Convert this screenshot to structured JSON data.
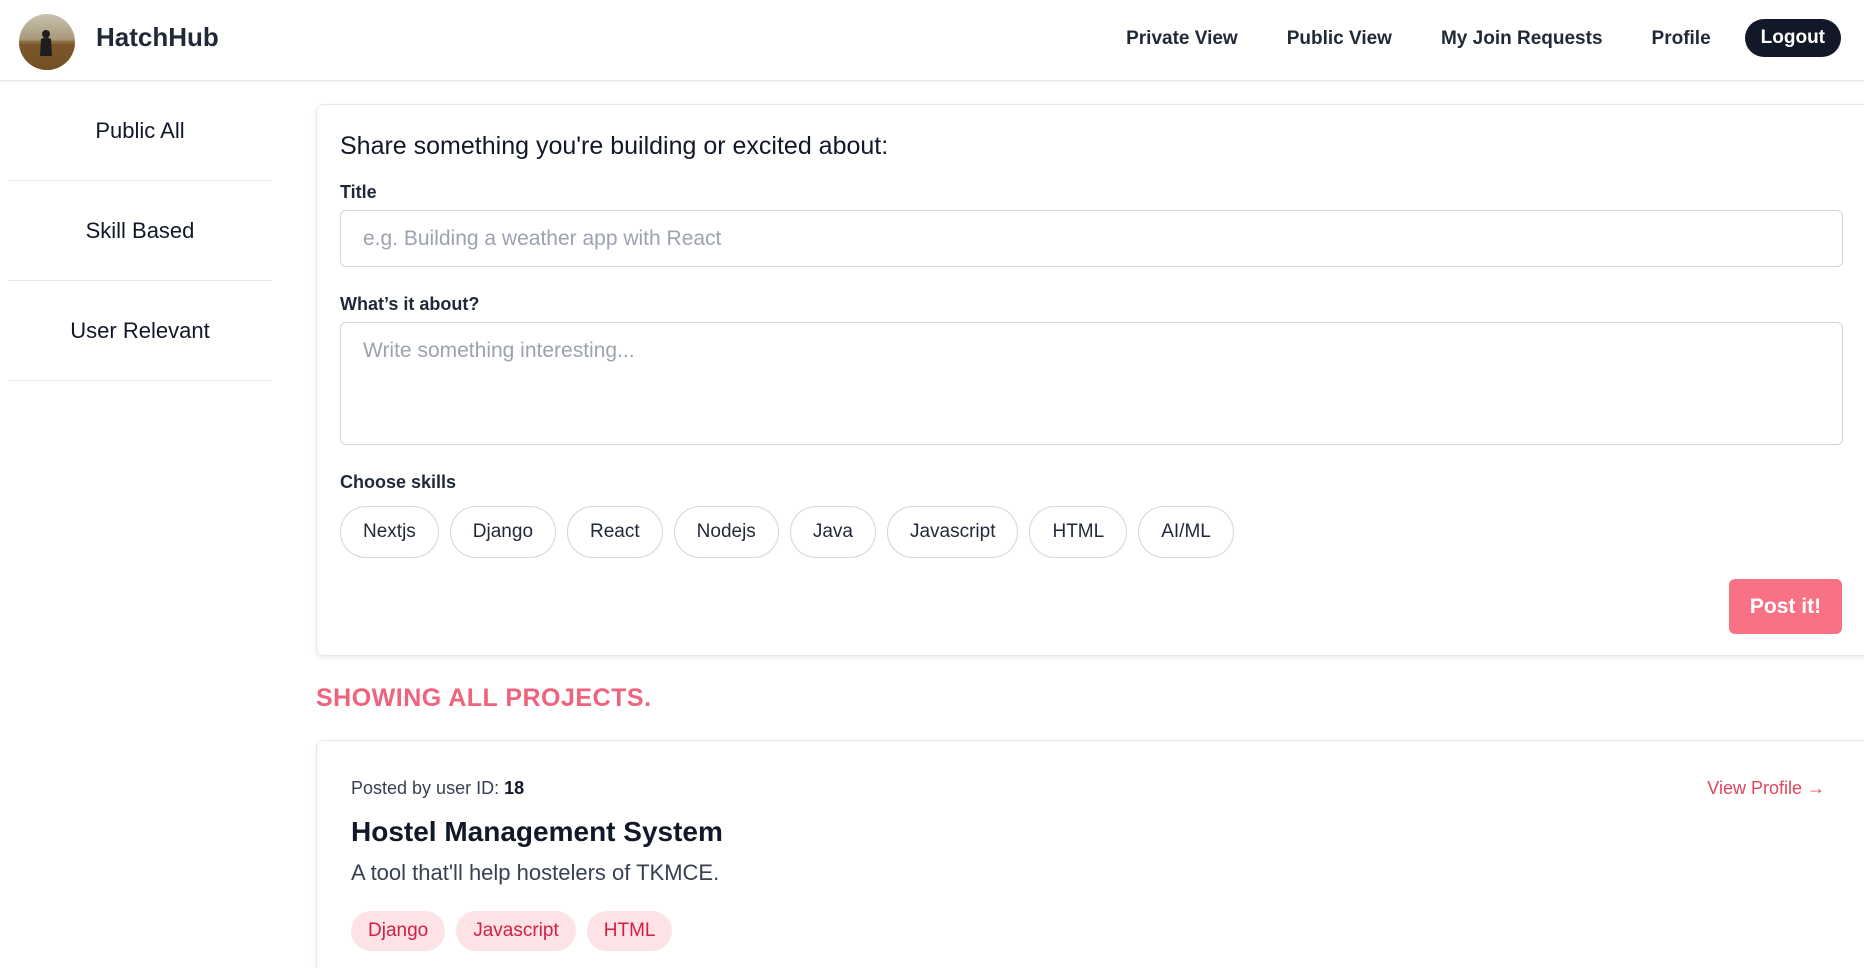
{
  "header": {
    "brand": "HatchHub",
    "nav": [
      "Private View",
      "Public View",
      "My Join Requests",
      "Profile"
    ],
    "logout_label": "Logout"
  },
  "sidebar": {
    "items": [
      {
        "label": "Public All"
      },
      {
        "label": "Skill Based"
      },
      {
        "label": "User Relevant"
      }
    ]
  },
  "composer": {
    "heading": "Share something you're building or excited about:",
    "title_label": "Title",
    "title_placeholder": "e.g. Building a weather app with React",
    "title_value": "",
    "about_label": "What’s it about?",
    "about_placeholder": "Write something interesting...",
    "about_value": "",
    "skills_label": "Choose skills",
    "skills": [
      "Nextjs",
      "Django",
      "React",
      "Nodejs",
      "Java",
      "Javascript",
      "HTML",
      "AI/ML"
    ],
    "post_label": "Post it!"
  },
  "feed": {
    "heading": "SHOWING ALL PROJECTS.",
    "projects": [
      {
        "posted_prefix": "Posted by user ID:",
        "user_id": "18",
        "view_profile": "View Profile →",
        "title": "Hostel Management System",
        "description": "A tool that'll help hostelers of TKMCE.",
        "tags": [
          "Django",
          "Javascript",
          "HTML"
        ]
      }
    ]
  },
  "colors": {
    "accent": "#f87185",
    "accent_text": "#f0637c",
    "tag_bg": "#fde2e6",
    "tag_text": "#d21f44",
    "dark": "#111827"
  }
}
